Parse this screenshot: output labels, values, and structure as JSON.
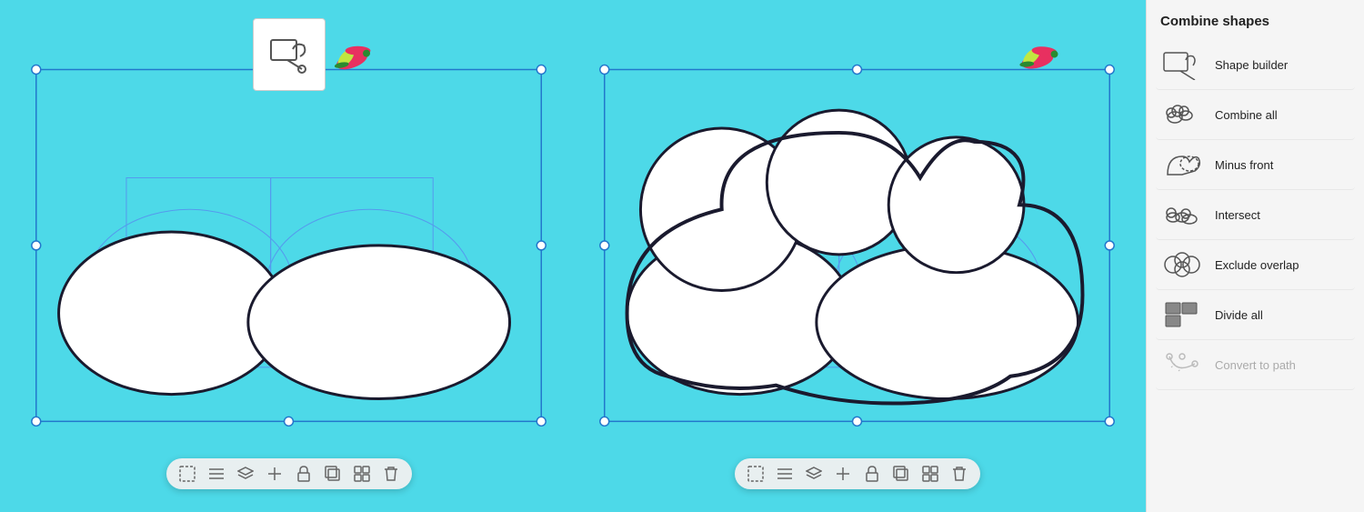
{
  "panel": {
    "title": "Combine shapes",
    "items": [
      {
        "id": "shape-builder",
        "label": "Shape builder",
        "disabled": false
      },
      {
        "id": "combine-all",
        "label": "Combine all",
        "disabled": false
      },
      {
        "id": "minus-front",
        "label": "Minus front",
        "disabled": false
      },
      {
        "id": "intersect",
        "label": "Intersect",
        "disabled": false
      },
      {
        "id": "exclude-overlap",
        "label": "Exclude overlap",
        "disabled": false
      },
      {
        "id": "divide-all",
        "label": "Divide all",
        "disabled": false
      },
      {
        "id": "convert-to-path",
        "label": "Convert to path",
        "disabled": true
      }
    ]
  },
  "canvas": {
    "background": "#4dd9e8"
  }
}
